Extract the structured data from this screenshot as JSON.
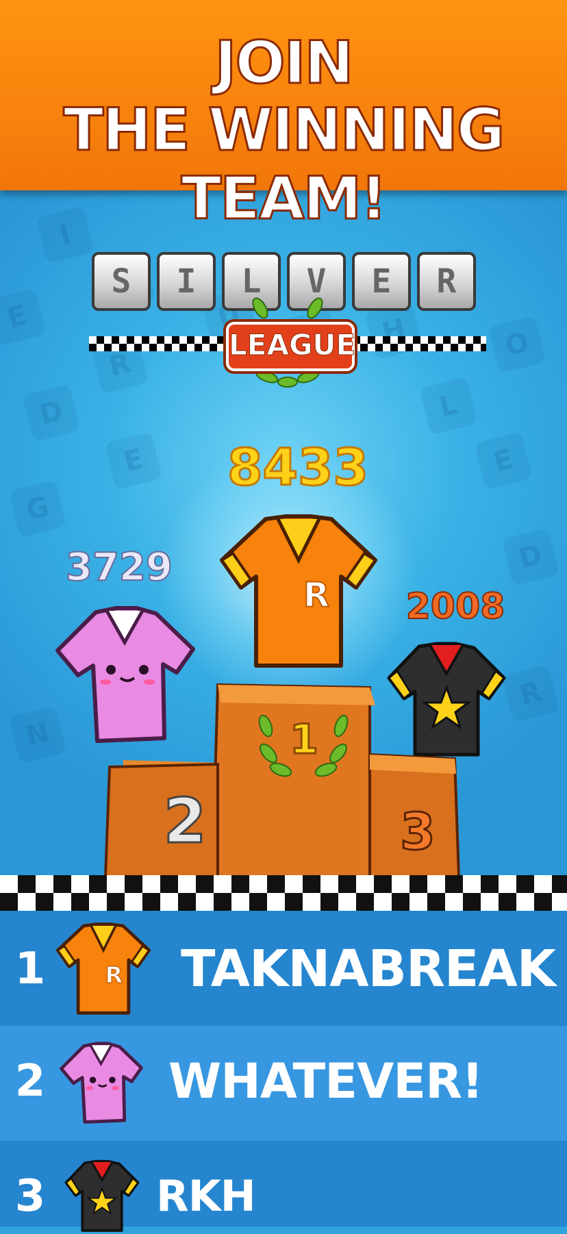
{
  "banner": {
    "line1": "JOIN",
    "line2": "THE WINNING TEAM!"
  },
  "league": {
    "tiles": [
      "S",
      "I",
      "L",
      "V",
      "E",
      "R"
    ],
    "label": "LEAGUE"
  },
  "podium": {
    "first": {
      "score": "8433",
      "place": "1"
    },
    "second": {
      "score": "3729",
      "place": "2"
    },
    "third": {
      "score": "2008",
      "place": "3"
    }
  },
  "leaderboard": [
    {
      "rank": "1",
      "name": "TAKNABREAK",
      "jersey_letter": "R"
    },
    {
      "rank": "2",
      "name": "WHATEVER!"
    },
    {
      "rank": "3",
      "name": "RKH"
    }
  ],
  "colors": {
    "banner": "#f7820c",
    "sky": "#2fa3dc",
    "row_dark": "#2585cf",
    "row_light": "#3797e1",
    "score_gold": "#ffd21a",
    "podium": "#e0761f"
  },
  "icons": [
    "laurel-icon",
    "orange-jersey-icon",
    "pink-jersey-icon",
    "black-jersey-icon",
    "star-icon"
  ]
}
